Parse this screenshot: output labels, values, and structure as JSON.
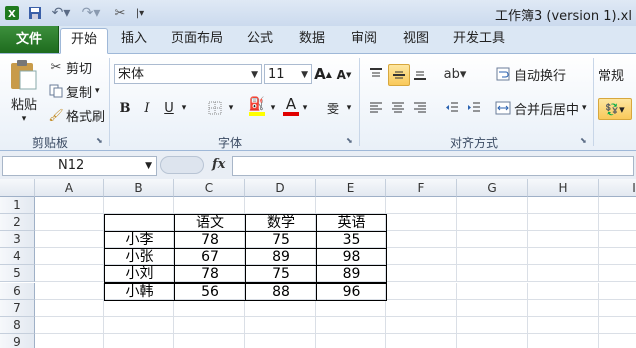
{
  "window": {
    "title": "工作簿3 (version 1).xl"
  },
  "tabs": [
    {
      "label": "文件"
    },
    {
      "label": "开始"
    },
    {
      "label": "插入"
    },
    {
      "label": "页面布局"
    },
    {
      "label": "公式"
    },
    {
      "label": "数据"
    },
    {
      "label": "审阅"
    },
    {
      "label": "视图"
    },
    {
      "label": "开发工具"
    }
  ],
  "ribbon": {
    "clipboard": {
      "paste": "粘贴",
      "cut": "剪切",
      "copy": "复制",
      "format_painter": "格式刷",
      "group": "剪贴板"
    },
    "font": {
      "name": "宋体",
      "size": "11",
      "bold": "B",
      "italic": "I",
      "underline": "U",
      "grow": "A",
      "shrink": "A",
      "font_color_letter": "A",
      "group": "字体"
    },
    "alignment": {
      "wrap": "自动换行",
      "merge": "合并后居中",
      "group": "对齐方式"
    },
    "number": {
      "format": "常规"
    },
    "colors": {
      "highlight": "#ffff00",
      "font_color": "#e00000"
    }
  },
  "formula_bar": {
    "name_box": "N12",
    "fx": "fx",
    "value": ""
  },
  "sheet": {
    "columns": [
      "A",
      "B",
      "C",
      "D",
      "E",
      "F",
      "G",
      "H",
      "I"
    ],
    "rows": [
      "1",
      "2",
      "3",
      "4",
      "5",
      "6",
      "7",
      "8",
      "9"
    ],
    "table": [
      [
        "",
        "语文",
        "数学",
        "英语"
      ],
      [
        "小李",
        "78",
        "75",
        "35"
      ],
      [
        "小张",
        "67",
        "89",
        "98"
      ],
      [
        "小刘",
        "78",
        "75",
        "89"
      ],
      [
        "小韩",
        "56",
        "88",
        "96"
      ]
    ]
  }
}
